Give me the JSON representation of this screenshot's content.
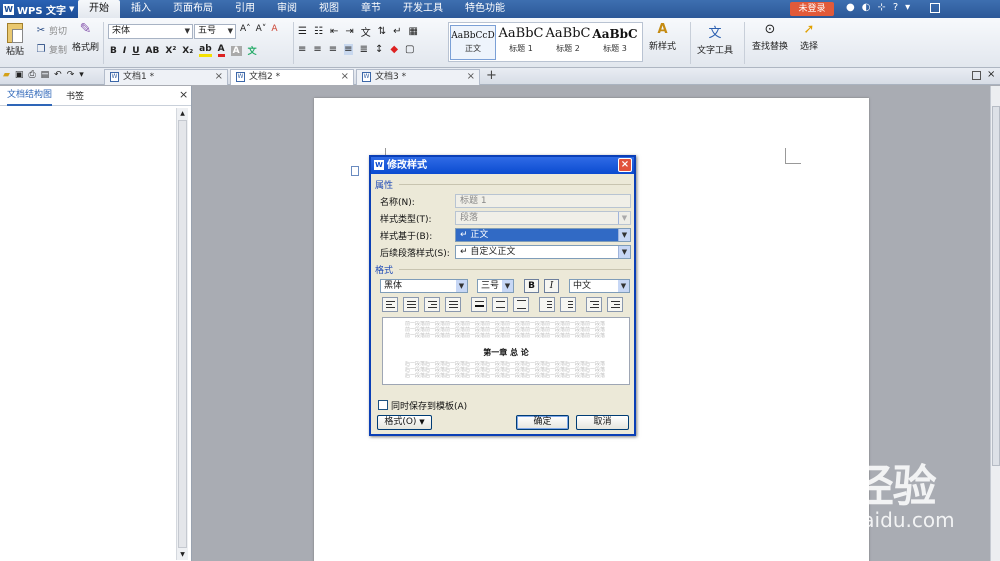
{
  "menubar": {
    "app_name": "WPS 文字",
    "menus": [
      "开始",
      "插入",
      "页面布局",
      "引用",
      "审阅",
      "视图",
      "章节",
      "开发工具",
      "特色功能"
    ],
    "active_menu": "开始",
    "login": "未登录",
    "controls": [
      "●",
      "◐",
      "⊹",
      "?",
      "▾"
    ]
  },
  "ribbon": {
    "paste": "粘贴",
    "cut": "剪切",
    "copy": "复制",
    "format_painter": "格式刷",
    "font_name": "宋体",
    "font_size": "五号",
    "styles": [
      {
        "preview": "AaBbCcD",
        "name": "正文"
      },
      {
        "preview": "AaBbC",
        "name": "标题 1"
      },
      {
        "preview": "AaBbC",
        "name": "标题 2"
      },
      {
        "preview": "AaBbC",
        "name": "标题 3"
      }
    ],
    "new_style": "新样式",
    "text_tools": "文字工具",
    "find_replace": "查找替换",
    "select": "选择"
  },
  "tabs": [
    {
      "title": "文档1 *"
    },
    {
      "title": "文档2 *"
    },
    {
      "title": "文档3 *"
    }
  ],
  "left_panel": {
    "tab_outline": "文档结构图",
    "tab_bookmark": "书签"
  },
  "dialog": {
    "title": "修改样式",
    "section_properties": "属性",
    "name_label": "名称(N):",
    "name_value": "标题 1",
    "style_type_label": "样式类型(T):",
    "style_type_value": "段落",
    "based_on_label": "样式基于(B):",
    "based_on_value": "↵ 正文",
    "next_style_label": "后续段落样式(S):",
    "next_style_value": "↵ 自定义正文",
    "section_format": "格式",
    "font": "黑体",
    "size": "三号",
    "bold": "B",
    "italic": "I",
    "script": "中文",
    "preview_before": "前一段落前一段落前一段落前一段落前一段落前一段落前一段落前一段落前一段落前一段落前一段落前一段落",
    "preview_heading": "第一章  总 论",
    "preview_after": "后一段落后一段落后一段落后一段落后一段落后一段落后一段落后一段落后一段落后一段落后一段落后一段落",
    "save_to_template": "同时保存到模板(A)",
    "format_button": "格式(O)",
    "ok": "确定",
    "cancel": "取消"
  },
  "watermark": {
    "brand": "Bai 经验",
    "url": "jingyan.baidu.com"
  }
}
